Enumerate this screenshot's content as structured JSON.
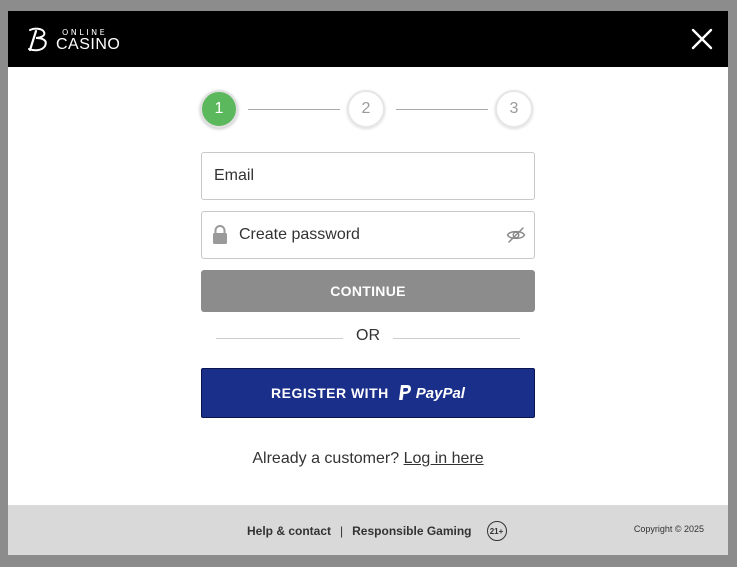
{
  "header": {
    "logo_online": "ONLINE",
    "logo_casino": "CASINO"
  },
  "stepper": {
    "steps": [
      "1",
      "2",
      "3"
    ],
    "active_step": 1,
    "active_color": "#5cb85c"
  },
  "form": {
    "email_placeholder": "Email",
    "password_placeholder": "Create password",
    "continue_label": "CONTINUE",
    "or_label": "OR",
    "paypal_prefix": "REGISTER WITH",
    "paypal_brand": "PayPal",
    "paypal_color": "#1a2f8a"
  },
  "login": {
    "prompt": "Already a customer?",
    "link": "Log in here"
  },
  "footer": {
    "help": "Help & contact",
    "separator": "|",
    "responsible": "Responsible Gaming",
    "age": "21+",
    "copyright": "Copyright © 2025"
  },
  "icons": [
    "b-logo-icon",
    "close-icon",
    "lock-icon",
    "eye-slash-icon",
    "paypal-icon"
  ]
}
